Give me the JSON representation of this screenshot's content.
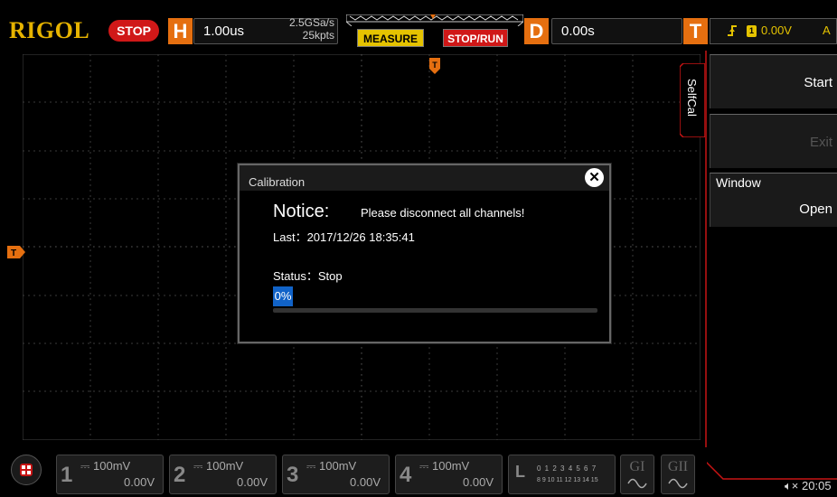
{
  "header": {
    "brand": "RIGOL",
    "run_state": "STOP",
    "horizontal": {
      "label": "H",
      "timebase": "1.00us",
      "sample_rate": "2.5GSa/s",
      "memory_depth": "25kpts"
    },
    "measure_label": "MEASURE",
    "stoprun_label": "STOP/RUN",
    "delay": {
      "label": "D",
      "value": "0.00s"
    },
    "trigger": {
      "label": "T",
      "source": "1",
      "level": "0.00V",
      "mode": "A"
    }
  },
  "dialog": {
    "title": "Calibration",
    "close_icon": "close-icon",
    "notice_heading": "Notice:",
    "notice_text": "Please disconnect all channels!",
    "last_run": "Last：2017/12/26 18:35:41",
    "status": "Status：Stop",
    "progress_label": "0%",
    "progress": 0
  },
  "menu": {
    "tab_label": "SelfCal",
    "items": [
      {
        "label": "Start",
        "enabled": true
      },
      {
        "label": "Exit",
        "enabled": false
      },
      {
        "title": "Window",
        "label": "Open",
        "enabled": true
      }
    ]
  },
  "channels": [
    {
      "num": "1",
      "scale": "100mV",
      "offset": "0.00V"
    },
    {
      "num": "2",
      "scale": "100mV",
      "offset": "0.00V"
    },
    {
      "num": "3",
      "scale": "100mV",
      "offset": "0.00V"
    },
    {
      "num": "4",
      "scale": "100mV",
      "offset": "0.00V"
    }
  ],
  "logic": {
    "label": "L",
    "row1": "0 1 2 3  4 5 6 7",
    "row2": "8 9 10 11  12 13 14 15"
  },
  "generators": [
    {
      "label": "GI"
    },
    {
      "label": "GII"
    }
  ],
  "status_bar": {
    "clock": "20:05",
    "speaker_icon": "speaker-muted-icon"
  },
  "colors": {
    "accent_orange": "#e56f10",
    "trigger_yellow": "#e5c300",
    "stop_red": "#d01818",
    "progress_blue": "#1163c8"
  }
}
